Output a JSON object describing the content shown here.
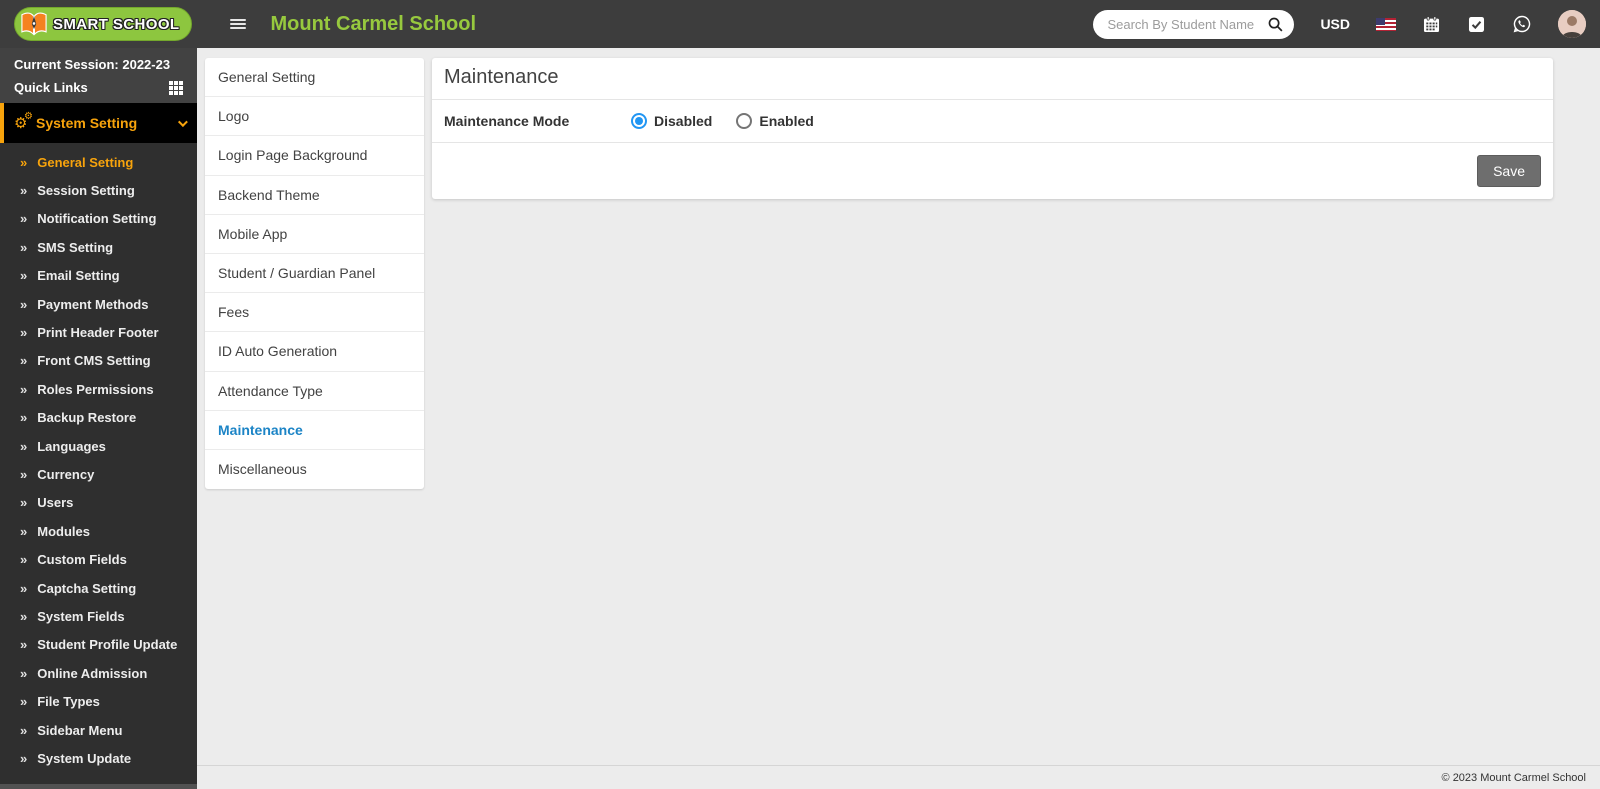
{
  "header": {
    "brand": "SMART SCHOOL",
    "school_name": "Mount Carmel School",
    "search_placeholder": "Search By Student Name",
    "currency": "USD"
  },
  "sidebar": {
    "session_label": "Current Session: 2022-23",
    "quick_links_label": "Quick Links",
    "menu_label": "System Setting",
    "items": [
      {
        "label": "General Setting",
        "active": true
      },
      {
        "label": "Session Setting",
        "active": false
      },
      {
        "label": "Notification Setting",
        "active": false
      },
      {
        "label": "SMS Setting",
        "active": false
      },
      {
        "label": "Email Setting",
        "active": false
      },
      {
        "label": "Payment Methods",
        "active": false
      },
      {
        "label": "Print Header Footer",
        "active": false
      },
      {
        "label": "Front CMS Setting",
        "active": false
      },
      {
        "label": "Roles Permissions",
        "active": false
      },
      {
        "label": "Backup Restore",
        "active": false
      },
      {
        "label": "Languages",
        "active": false
      },
      {
        "label": "Currency",
        "active": false
      },
      {
        "label": "Users",
        "active": false
      },
      {
        "label": "Modules",
        "active": false
      },
      {
        "label": "Custom Fields",
        "active": false
      },
      {
        "label": "Captcha Setting",
        "active": false
      },
      {
        "label": "System Fields",
        "active": false
      },
      {
        "label": "Student Profile Update",
        "active": false
      },
      {
        "label": "Online Admission",
        "active": false
      },
      {
        "label": "File Types",
        "active": false
      },
      {
        "label": "Sidebar Menu",
        "active": false
      },
      {
        "label": "System Update",
        "active": false
      }
    ]
  },
  "tabs": [
    {
      "label": "General Setting",
      "active": false
    },
    {
      "label": "Logo",
      "active": false
    },
    {
      "label": "Login Page Background",
      "active": false
    },
    {
      "label": "Backend Theme",
      "active": false
    },
    {
      "label": "Mobile App",
      "active": false
    },
    {
      "label": "Student / Guardian Panel",
      "active": false
    },
    {
      "label": "Fees",
      "active": false
    },
    {
      "label": "ID Auto Generation",
      "active": false
    },
    {
      "label": "Attendance Type",
      "active": false
    },
    {
      "label": "Maintenance",
      "active": true
    },
    {
      "label": "Miscellaneous",
      "active": false
    }
  ],
  "main": {
    "title": "Maintenance",
    "form": {
      "field_label": "Maintenance Mode",
      "options": [
        {
          "label": "Disabled",
          "selected": true
        },
        {
          "label": "Enabled",
          "selected": false
        }
      ]
    },
    "save_label": "Save"
  },
  "footer": {
    "copyright": "© 2023 Mount Carmel School"
  },
  "icons": {
    "item_bullet": "»",
    "gear_glyph": "⚙"
  },
  "colors": {
    "header_bg": "#3d3d3d",
    "sidebar_bg": "#2f2f2f",
    "accent_orange": "#f7a30c",
    "brand_green": "#8dc63f",
    "title_green": "#97c93e",
    "active_tab_blue": "#1c84c6",
    "radio_blue": "#2196f3",
    "save_button_gray": "#6e6e6e",
    "content_bg": "#ececec"
  }
}
